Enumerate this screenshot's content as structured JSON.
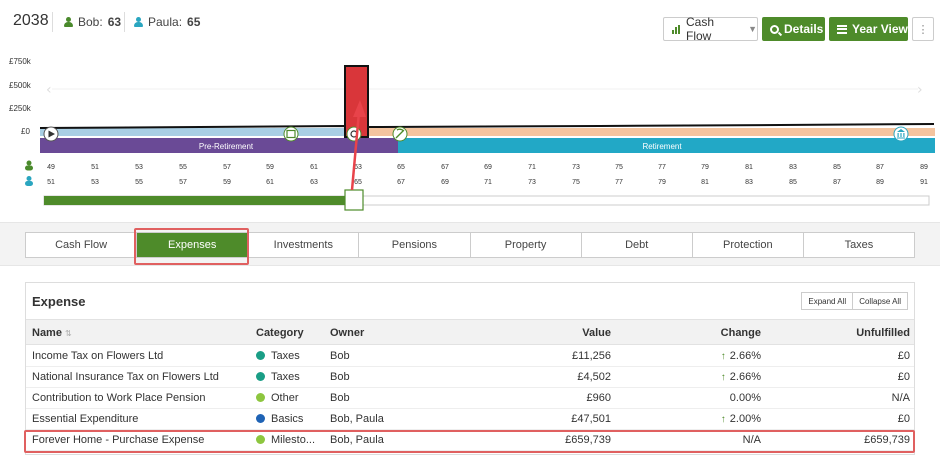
{
  "header": {
    "year": "2038",
    "people": [
      {
        "name": "Bob:",
        "age": "63"
      },
      {
        "name": "Paula:",
        "age": "65"
      }
    ],
    "view_select": "Cash Flow",
    "details_label": "Details",
    "year_view_label": "Year View",
    "more_label": "⋮"
  },
  "chart": {
    "y_labels": [
      "£750k",
      "£500k",
      "£250k",
      "£0"
    ],
    "phases": [
      "Pre-Retirement",
      "Retirement"
    ],
    "bob_ages": [
      "49",
      "51",
      "53",
      "55",
      "57",
      "59",
      "61",
      "63",
      "65",
      "67",
      "69",
      "71",
      "73",
      "75",
      "77",
      "79",
      "81",
      "83",
      "85",
      "87",
      "89"
    ],
    "paula_ages": [
      "51",
      "53",
      "55",
      "57",
      "59",
      "61",
      "63",
      "65",
      "67",
      "69",
      "71",
      "73",
      "75",
      "77",
      "79",
      "81",
      "83",
      "85",
      "87",
      "89",
      "91"
    ],
    "colors": {
      "pre": "#6a4a96",
      "ret": "#22a8c6",
      "spike": "#d9363a",
      "progress": "#4e8b2a",
      "peach": "#f4c49f"
    }
  },
  "tabs": [
    "Cash Flow",
    "Expenses",
    "Investments",
    "Pensions",
    "Property",
    "Debt",
    "Protection",
    "Taxes"
  ],
  "active_tab": "Expenses",
  "expense": {
    "title": "Expense",
    "expand_all": "Expand All",
    "collapse_all": "Collapse All",
    "columns": {
      "name": "Name",
      "sort": "⇅",
      "category": "Category",
      "owner": "Owner",
      "value": "Value",
      "change": "Change",
      "unfulfilled": "Unfulfilled"
    },
    "rows": [
      {
        "name": "Income Tax on Flowers Ltd",
        "category": "Taxes",
        "color": "#1a9e86",
        "owner": "Bob",
        "value": "£11,256",
        "change": "2.66%",
        "up": true,
        "unfulfilled": "£0"
      },
      {
        "name": "National Insurance Tax on Flowers Ltd",
        "category": "Taxes",
        "color": "#1a9e86",
        "owner": "Bob",
        "value": "£4,502",
        "change": "2.66%",
        "up": true,
        "unfulfilled": "£0"
      },
      {
        "name": "Contribution to Work Place Pension",
        "category": "Other",
        "color": "#8dc63f",
        "owner": "Bob",
        "value": "£960",
        "change": "0.00%",
        "up": false,
        "unfulfilled": "N/A"
      },
      {
        "name": "Essential Expenditure",
        "category": "Basics",
        "color": "#1f63b5",
        "owner": "Bob, Paula",
        "value": "£47,501",
        "change": "2.00%",
        "up": true,
        "unfulfilled": "£0"
      },
      {
        "name": "Forever Home - Purchase Expense",
        "category": "Milesto...",
        "color": "#8dc63f",
        "owner": "Bob, Paula",
        "value": "£659,739",
        "change": "N/A",
        "up": false,
        "unfulfilled": "£659,739"
      }
    ]
  }
}
